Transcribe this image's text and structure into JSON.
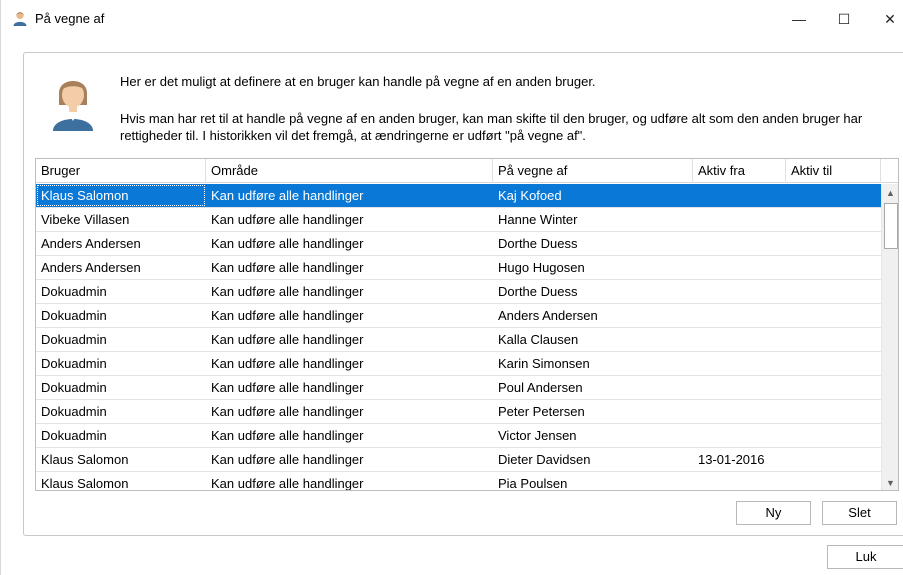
{
  "window": {
    "title": "På vegne af",
    "minimize_glyph": "—",
    "maximize_glyph": "☐",
    "close_glyph": "✕"
  },
  "intro": {
    "line1": "Her er det muligt at definere at en bruger kan handle på vegne af en anden bruger.",
    "line2": "Hvis man har ret til at handle på vegne af en anden bruger, kan man skifte til den bruger, og udføre alt som den anden bruger har rettigheder til. I historikken vil det fremgå, at ændringerne er udført \"på vegne af\"."
  },
  "table": {
    "columns": [
      "Bruger",
      "Område",
      "På vegne af",
      "Aktiv fra",
      "Aktiv til"
    ],
    "selected_row": 0,
    "rows": [
      [
        "Klaus Salomon",
        "Kan udføre alle handlinger",
        "Kaj Kofoed",
        "",
        ""
      ],
      [
        "Vibeke Villasen",
        "Kan udføre alle handlinger",
        "Hanne Winter",
        "",
        ""
      ],
      [
        "Anders Andersen",
        "Kan udføre alle handlinger",
        "Dorthe Duess",
        "",
        ""
      ],
      [
        "Anders Andersen",
        "Kan udføre alle handlinger",
        "Hugo Hugosen",
        "",
        ""
      ],
      [
        "Dokuadmin",
        "Kan udføre alle handlinger",
        "Dorthe Duess",
        "",
        ""
      ],
      [
        "Dokuadmin",
        "Kan udføre alle handlinger",
        "Anders Andersen",
        "",
        ""
      ],
      [
        "Dokuadmin",
        "Kan udføre alle handlinger",
        "Kalla Clausen",
        "",
        ""
      ],
      [
        "Dokuadmin",
        "Kan udføre alle handlinger",
        "Karin Simonsen",
        "",
        ""
      ],
      [
        "Dokuadmin",
        "Kan udføre alle handlinger",
        "Poul Andersen",
        "",
        ""
      ],
      [
        "Dokuadmin",
        "Kan udføre alle handlinger",
        "Peter Petersen",
        "",
        ""
      ],
      [
        "Dokuadmin",
        "Kan udføre alle handlinger",
        "Victor Jensen",
        "",
        ""
      ],
      [
        "Klaus Salomon",
        "Kan udføre alle handlinger",
        "Dieter Davidsen",
        "13-01-2016",
        ""
      ],
      [
        "Klaus Salomon",
        "Kan udføre alle handlinger",
        "Pia Poulsen",
        "",
        ""
      ]
    ]
  },
  "scrollbar": {
    "up_glyph": "▲",
    "down_glyph": "▼"
  },
  "buttons": {
    "new_label": "Ny",
    "delete_label": "Slet",
    "close_label": "Luk"
  },
  "icons": {
    "title_icon": "user-icon",
    "avatar_icon": "user-avatar-icon"
  },
  "colors": {
    "selection": "#0a78d7"
  }
}
